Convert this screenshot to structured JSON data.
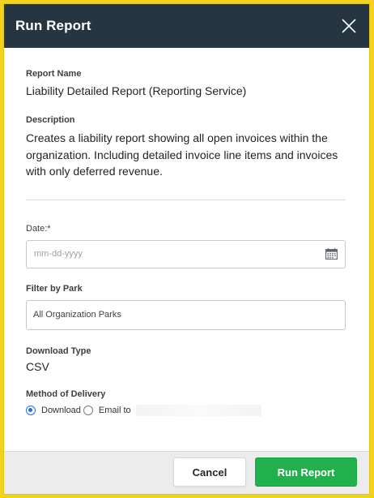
{
  "modal": {
    "title": "Run Report"
  },
  "report": {
    "name_label": "Report Name",
    "name_value": "Liability Detailed Report (Reporting Service)",
    "description_label": "Description",
    "description_value": "Creates a liability report showing all open invoices within the organization. Including detailed invoice line items and invoices with only deferred revenue."
  },
  "date_field": {
    "label": "Date:*",
    "placeholder": "mm-dd-yyyy",
    "value": ""
  },
  "park_filter": {
    "label": "Filter by Park",
    "selected": "All Organization Parks"
  },
  "download_type": {
    "label": "Download Type",
    "value": "CSV"
  },
  "delivery": {
    "label": "Method of Delivery",
    "options": [
      {
        "label": "Download",
        "checked": true
      },
      {
        "label": "Email to",
        "checked": false
      }
    ]
  },
  "footer": {
    "cancel_label": "Cancel",
    "run_label": "Run Report"
  },
  "colors": {
    "header_bg": "#253642",
    "primary": "#20b14c",
    "radio_accent": "#1b6fe0",
    "page_backdrop": "#f2d21c"
  },
  "icons": {
    "close": "close-icon",
    "calendar": "calendar-icon"
  }
}
